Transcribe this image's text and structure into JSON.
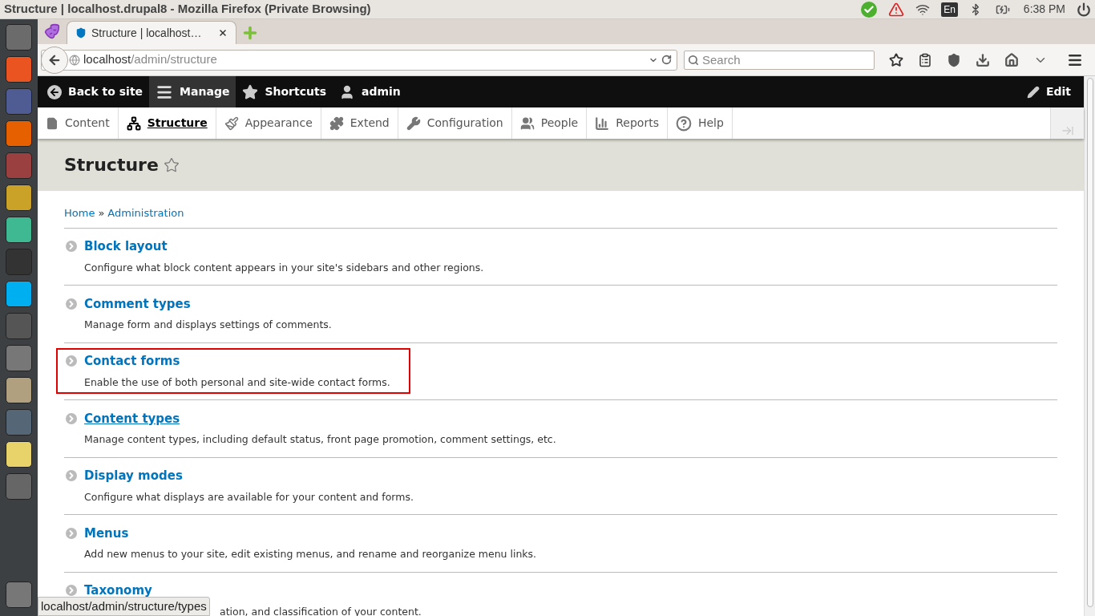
{
  "os_panel": {
    "window_title": "Structure | localhost.drupal8 - Mozilla Firefox (Private Browsing)",
    "keyboard": "En",
    "clock": "6:38 PM"
  },
  "browser": {
    "tab": {
      "title": "Structure | localhost…",
      "selected": true
    },
    "url_host": "localhost",
    "url_path": "/admin/structure",
    "search": {
      "placeholder": "Search"
    }
  },
  "toolbar": {
    "items": [
      {
        "label": "Back to site",
        "selected": false
      },
      {
        "label": "Manage",
        "selected": true
      },
      {
        "label": "Shortcuts",
        "selected": false
      },
      {
        "label": "admin",
        "selected": false
      }
    ],
    "edit": "Edit"
  },
  "tray": {
    "items": [
      {
        "label": "Content",
        "selected": false
      },
      {
        "label": "Structure",
        "selected": true
      },
      {
        "label": "Appearance",
        "selected": false
      },
      {
        "label": "Extend",
        "selected": false
      },
      {
        "label": "Configuration",
        "selected": false
      },
      {
        "label": "People",
        "selected": false
      },
      {
        "label": "Reports",
        "selected": false
      },
      {
        "label": "Help",
        "selected": false
      }
    ]
  },
  "page": {
    "title": "Structure",
    "breadcrumb": [
      "Home",
      "Administration"
    ],
    "breadcrumb_separator": "»"
  },
  "items": [
    {
      "title": "Block layout",
      "description": "Configure what block content appears in your site's sidebars and other regions.",
      "highlighted": false,
      "hovered": false,
      "partly_covered": false
    },
    {
      "title": "Comment types",
      "description": "Manage form and displays settings of comments.",
      "highlighted": false,
      "hovered": false,
      "partly_covered": false
    },
    {
      "title": "Contact forms",
      "description": "Enable the use of both personal and site-wide contact forms.",
      "highlighted": true,
      "hovered": false,
      "partly_covered": false
    },
    {
      "title": "Content types",
      "description": "Manage content types, including default status, front page promotion, comment settings, etc.",
      "highlighted": false,
      "hovered": true,
      "partly_covered": false
    },
    {
      "title": "Display modes",
      "description": "Configure what displays are available for your content and forms.",
      "highlighted": false,
      "hovered": false,
      "partly_covered": false
    },
    {
      "title": "Menus",
      "description": "Add new menus to your site, edit existing menus, and rename and reorganize menu links.",
      "highlighted": false,
      "hovered": false,
      "partly_covered": false
    },
    {
      "title": "Taxonomy",
      "description": "ation, and classification of your content.",
      "highlighted": false,
      "hovered": false,
      "partly_covered": true
    }
  ],
  "status_url": "localhost/admin/structure/types"
}
